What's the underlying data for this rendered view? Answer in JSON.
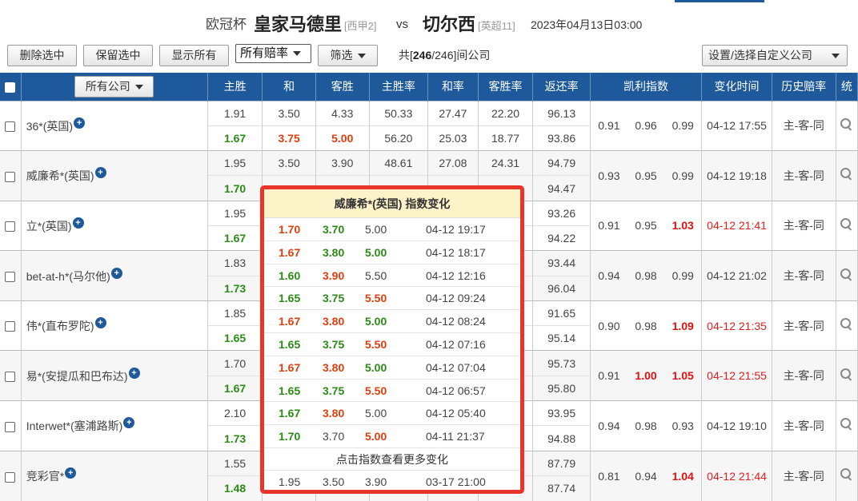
{
  "match": {
    "league": "欧冠杯",
    "home_team": "皇家马德里",
    "home_rank": "[西甲2]",
    "vs": "vs",
    "away_team": "切尔西",
    "away_rank": "[英超11]",
    "datetime": "2023年04月13日03:00"
  },
  "toolbar": {
    "delete_selected": "删除选中",
    "keep_selected": "保留选中",
    "show_all": "显示所有",
    "odds_select_value": "所有赔率",
    "filter": "筛选",
    "count_prefix": "共[",
    "count_shown": "246",
    "count_suffix": "/246]间公司",
    "settings": "设置/选择自定义公司"
  },
  "table": {
    "headers": {
      "all_companies": "所有公司",
      "home_win": "主胜",
      "draw": "和",
      "away_win": "客胜",
      "home_rate": "主胜率",
      "draw_rate": "和率",
      "away_rate": "客胜率",
      "return_rate": "返还率",
      "kelly": "凯利指数",
      "change_time": "变化时间",
      "history": "历史赔率",
      "stats": "统"
    },
    "rows": [
      {
        "company": "36*(英国)",
        "init": [
          "1.91",
          "3.50",
          "4.33"
        ],
        "init_rates": [
          "50.33",
          "27.47",
          "22.20"
        ],
        "init_return": "96.13",
        "live": [
          "1.67",
          "3.75",
          "5.00"
        ],
        "live_colors": [
          "green",
          "red",
          "red"
        ],
        "live_rates": [
          "56.20",
          "25.03",
          "18.77"
        ],
        "live_return": "93.86",
        "kelly": [
          "0.91",
          "0.96",
          "0.99"
        ],
        "kelly_hl": [
          false,
          false,
          false
        ],
        "time": "04-12 17:55",
        "time_red": false,
        "history": "主-客-同"
      },
      {
        "company": "威廉希*(英国)",
        "init": [
          "1.95",
          "3.50",
          "3.90"
        ],
        "init_rates": [
          "48.61",
          "27.08",
          "24.31"
        ],
        "init_return": "94.79",
        "live": [
          "1.70",
          "",
          ""
        ],
        "live_colors": [
          "green",
          "",
          ""
        ],
        "live_rates": [
          "",
          "",
          ""
        ],
        "live_return": "94.47",
        "kelly": [
          "0.93",
          "0.95",
          "0.99"
        ],
        "kelly_hl": [
          false,
          false,
          false
        ],
        "time": "04-12 19:18",
        "time_red": false,
        "history": "主-客-同"
      },
      {
        "company": "立*(英国)",
        "init": [
          "1.95",
          "",
          ""
        ],
        "init_rates": [
          "",
          "",
          ""
        ],
        "init_return": "93.26",
        "live": [
          "1.67",
          "",
          ""
        ],
        "live_colors": [
          "green",
          "",
          ""
        ],
        "live_rates": [
          "",
          "",
          ""
        ],
        "live_return": "94.22",
        "kelly": [
          "0.91",
          "0.95",
          "1.03"
        ],
        "kelly_hl": [
          false,
          false,
          true
        ],
        "time": "04-12 21:41",
        "time_red": true,
        "history": "主-客-同"
      },
      {
        "company": "bet-at-h*(马尔他)",
        "init": [
          "1.83",
          "",
          ""
        ],
        "init_rates": [
          "",
          "",
          ""
        ],
        "init_return": "93.44",
        "live": [
          "1.73",
          "",
          ""
        ],
        "live_colors": [
          "green",
          "",
          ""
        ],
        "live_rates": [
          "",
          "",
          ""
        ],
        "live_return": "96.04",
        "kelly": [
          "0.94",
          "0.98",
          "0.99"
        ],
        "kelly_hl": [
          false,
          false,
          false
        ],
        "time": "04-12 21:02",
        "time_red": false,
        "history": "主-客-同"
      },
      {
        "company": "伟*(直布罗陀)",
        "init": [
          "1.85",
          "",
          ""
        ],
        "init_rates": [
          "",
          "",
          ""
        ],
        "init_return": "91.65",
        "live": [
          "1.65",
          "",
          ""
        ],
        "live_colors": [
          "green",
          "",
          ""
        ],
        "live_rates": [
          "",
          "",
          ""
        ],
        "live_return": "95.14",
        "kelly": [
          "0.90",
          "0.98",
          "1.09"
        ],
        "kelly_hl": [
          false,
          false,
          true
        ],
        "time": "04-12 21:35",
        "time_red": true,
        "history": "主-客-同"
      },
      {
        "company": "易*(安提瓜和巴布达)",
        "init": [
          "1.70",
          "",
          ""
        ],
        "init_rates": [
          "",
          "",
          ""
        ],
        "init_return": "95.73",
        "live": [
          "1.67",
          "",
          ""
        ],
        "live_colors": [
          "green",
          "",
          ""
        ],
        "live_rates": [
          "",
          "",
          ""
        ],
        "live_return": "95.80",
        "kelly": [
          "0.91",
          "1.00",
          "1.05"
        ],
        "kelly_hl": [
          false,
          true,
          true
        ],
        "time": "04-12 21:55",
        "time_red": true,
        "history": "主-客-同"
      },
      {
        "company": "Interwet*(塞浦路斯)",
        "init": [
          "2.10",
          "",
          ""
        ],
        "init_rates": [
          "",
          "",
          ""
        ],
        "init_return": "93.95",
        "live": [
          "1.73",
          "",
          ""
        ],
        "live_colors": [
          "green",
          "",
          ""
        ],
        "live_rates": [
          "",
          "",
          ""
        ],
        "live_return": "94.88",
        "kelly": [
          "0.94",
          "0.98",
          "0.93"
        ],
        "kelly_hl": [
          false,
          false,
          false
        ],
        "time": "04-12 19:10",
        "time_red": false,
        "history": "主-客-同"
      },
      {
        "company": "竞彩官*",
        "init": [
          "1.55",
          "",
          ""
        ],
        "init_rates": [
          "",
          "",
          ""
        ],
        "init_return": "87.79",
        "live": [
          "1.48",
          "",
          ""
        ],
        "live_colors": [
          "green",
          "",
          ""
        ],
        "live_rates": [
          "",
          "",
          ""
        ],
        "live_return": "87.74",
        "kelly": [
          "0.81",
          "0.94",
          "1.04"
        ],
        "kelly_hl": [
          false,
          false,
          true
        ],
        "time": "04-12 21:44",
        "time_red": true,
        "history": "主-客-同"
      }
    ]
  },
  "popup": {
    "title": "威廉希*(英国) 指数变化",
    "rows": [
      {
        "h": "1.70",
        "d": "3.70",
        "a": "5.00",
        "t": "04-12 19:17",
        "hc": "red",
        "dc": "green",
        "ac": "plain"
      },
      {
        "h": "1.67",
        "d": "3.80",
        "a": "5.00",
        "t": "04-12 18:17",
        "hc": "red",
        "dc": "green",
        "ac": "green"
      },
      {
        "h": "1.60",
        "d": "3.90",
        "a": "5.50",
        "t": "04-12 12:16",
        "hc": "green",
        "dc": "red",
        "ac": "plain"
      },
      {
        "h": "1.65",
        "d": "3.75",
        "a": "5.50",
        "t": "04-12 09:24",
        "hc": "green",
        "dc": "green",
        "ac": "red"
      },
      {
        "h": "1.67",
        "d": "3.80",
        "a": "5.00",
        "t": "04-12 08:24",
        "hc": "red",
        "dc": "red",
        "ac": "green"
      },
      {
        "h": "1.65",
        "d": "3.75",
        "a": "5.50",
        "t": "04-12 07:16",
        "hc": "green",
        "dc": "green",
        "ac": "red"
      },
      {
        "h": "1.67",
        "d": "3.80",
        "a": "5.00",
        "t": "04-12 07:04",
        "hc": "red",
        "dc": "red",
        "ac": "green"
      },
      {
        "h": "1.65",
        "d": "3.75",
        "a": "5.50",
        "t": "04-12 06:57",
        "hc": "green",
        "dc": "green",
        "ac": "red"
      },
      {
        "h": "1.67",
        "d": "3.80",
        "a": "5.00",
        "t": "04-12 05:40",
        "hc": "green",
        "dc": "red",
        "ac": "plain"
      },
      {
        "h": "1.70",
        "d": "3.70",
        "a": "5.00",
        "t": "04-11 21:37",
        "hc": "green",
        "dc": "plain",
        "ac": "red"
      }
    ],
    "more": "点击指数查看更多变化",
    "first": {
      "h": "1.95",
      "d": "3.50",
      "a": "3.90",
      "t": "03-17 21:00"
    }
  },
  "colors": {
    "header_bg": "#1e5a9b",
    "green": "#2b8a15",
    "red": "#e03d0c",
    "popup_border": "#e8352b",
    "popup_title_bg": "#fdf3c8"
  }
}
